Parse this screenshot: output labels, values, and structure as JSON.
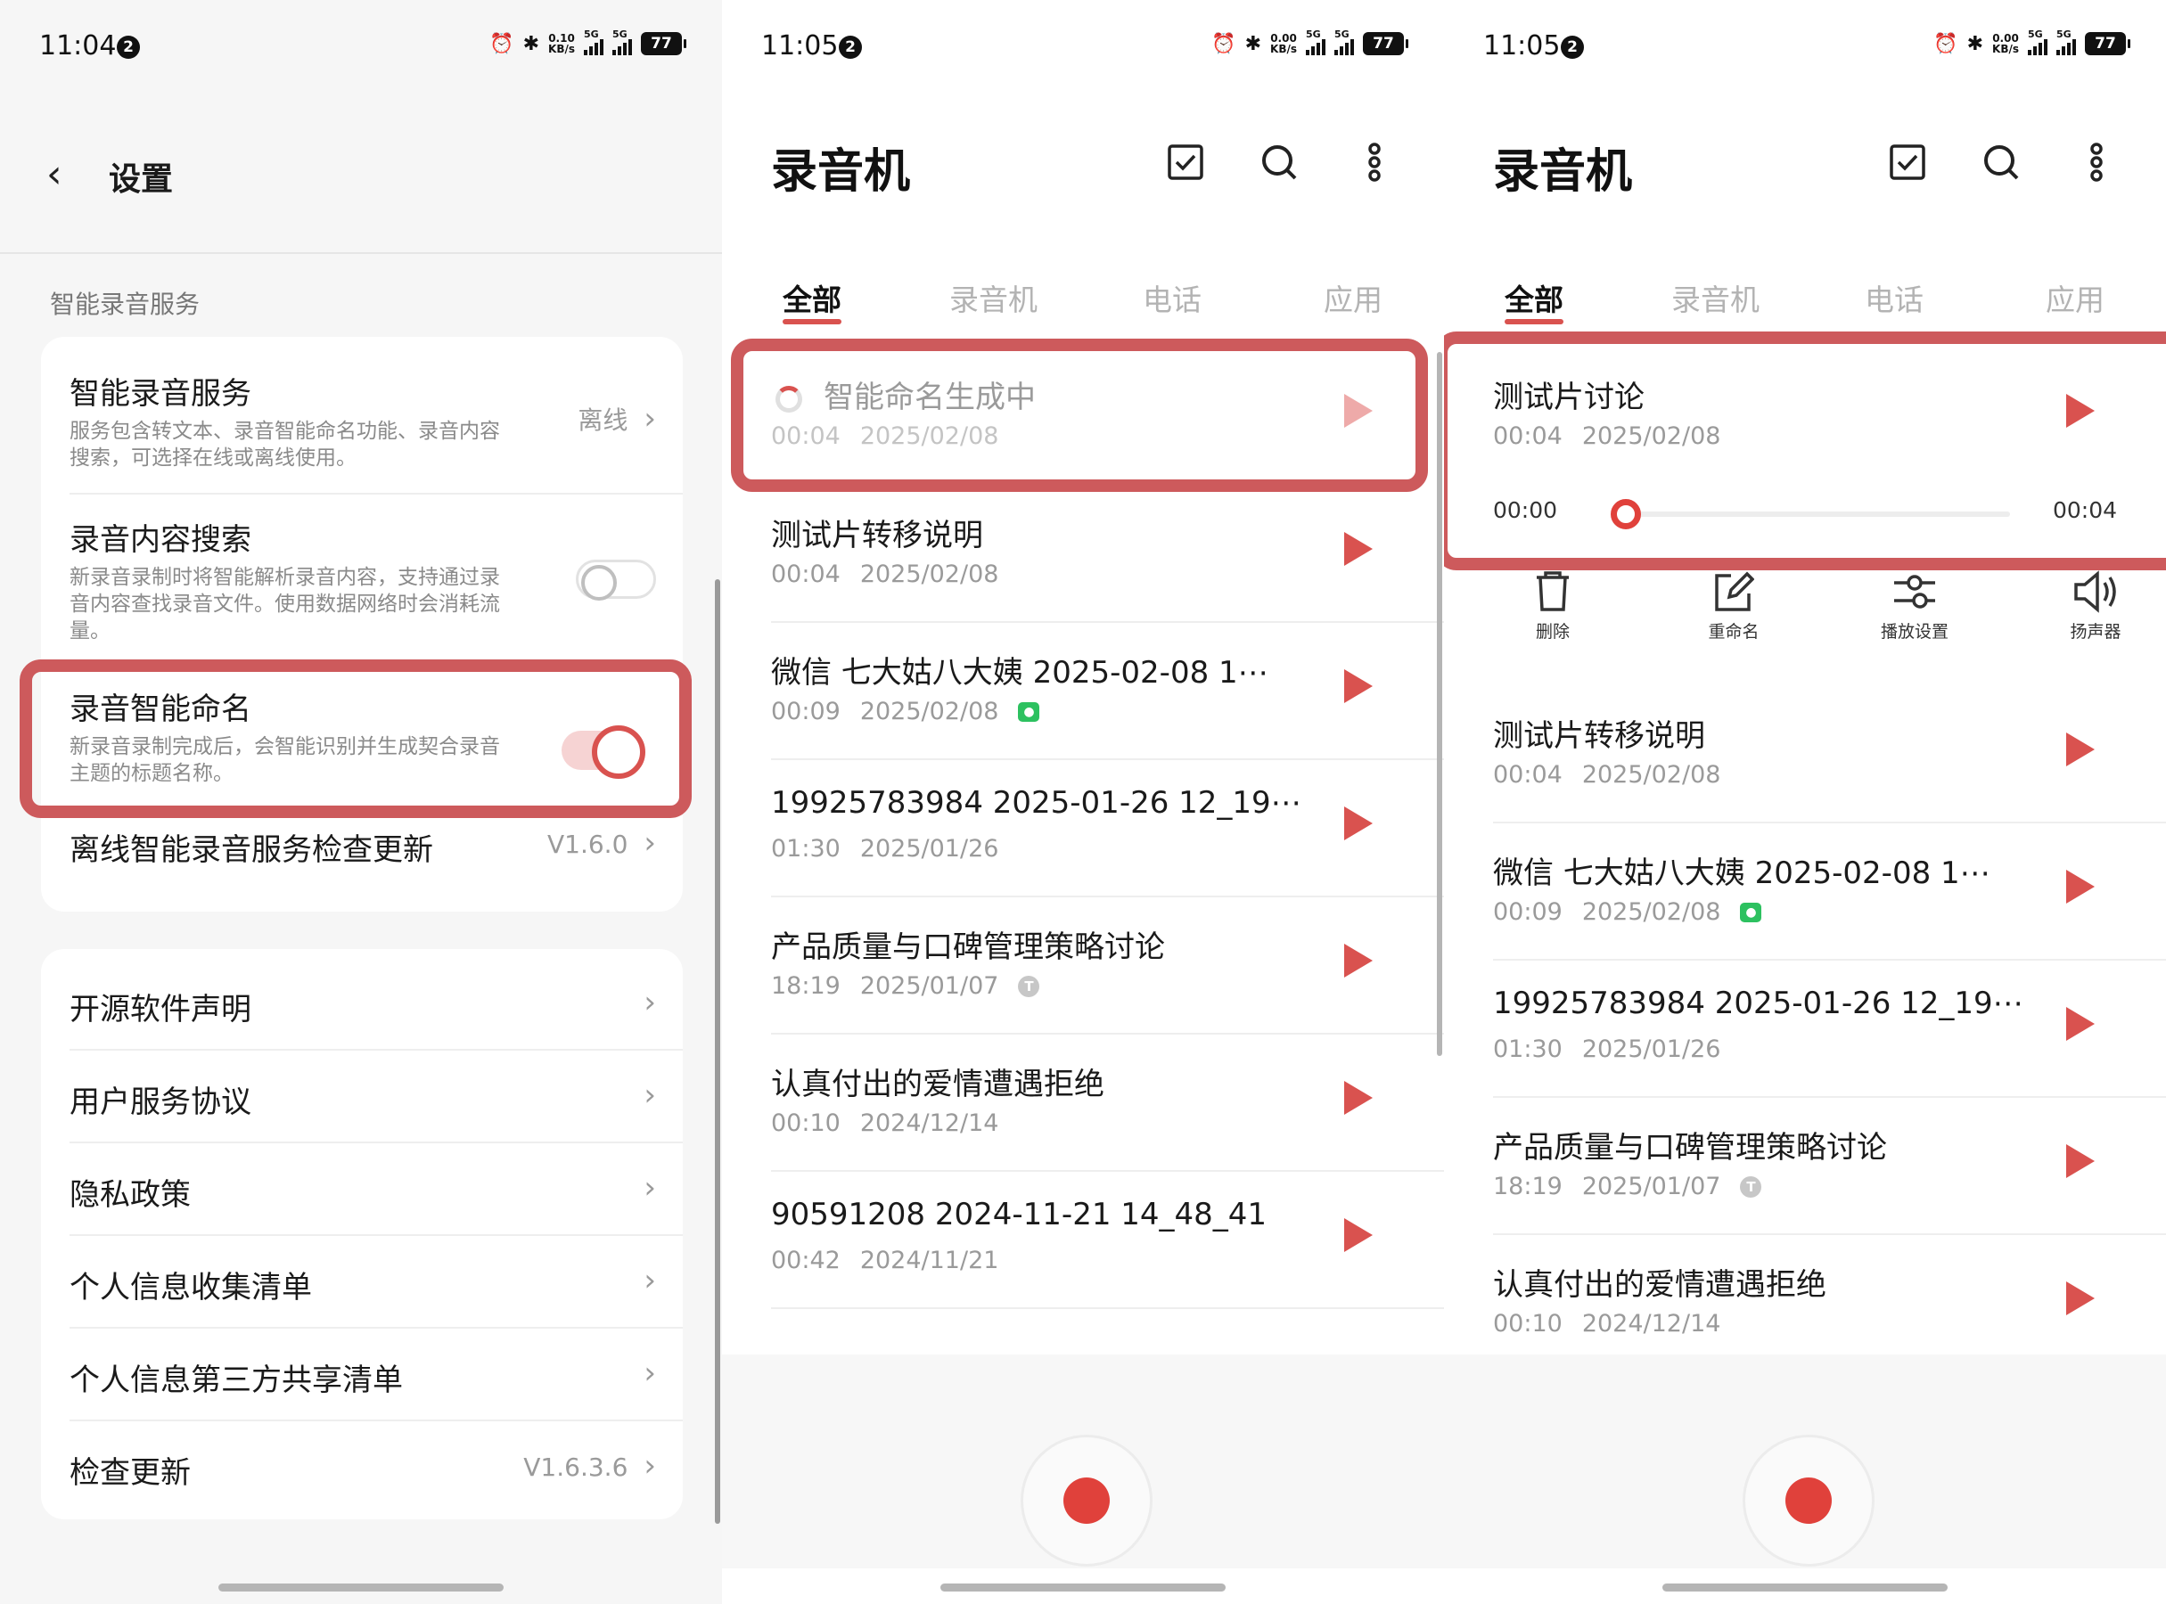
{
  "status_bars": [
    {
      "time": "11:04",
      "badge": "2",
      "speed": "0.10\nKB/s",
      "battery": "77",
      "net": "5G"
    },
    {
      "time": "11:05",
      "badge": "2",
      "speed": "0.00\nKB/s",
      "battery": "77",
      "net": "5G"
    },
    {
      "time": "11:05",
      "badge": "2",
      "speed": "0.00\nKB/s",
      "battery": "77",
      "net": "5G"
    }
  ],
  "settings": {
    "title": "设置",
    "section_label": "智能录音服务",
    "items": [
      {
        "title": "智能录音服务",
        "desc": "服务包含转文本、录音智能命名功能、录音内容搜索，可选择在线或离线使用。",
        "value": "离线"
      },
      {
        "title": "录音内容搜索",
        "desc": "新录音录制时将智能解析录音内容，支持通过录音内容查找录音文件。使用数据网络时会消耗流量。",
        "toggle": "off"
      },
      {
        "title": "录音智能命名",
        "desc": "新录音录制完成后，会智能识别并生成契合录音主题的标题名称。",
        "toggle": "on"
      },
      {
        "title": "离线智能录音服务检查更新",
        "value": "V1.6.0"
      }
    ],
    "other_items": [
      {
        "title": "开源软件声明"
      },
      {
        "title": "用户服务协议"
      },
      {
        "title": "隐私政策"
      },
      {
        "title": "个人信息收集清单"
      },
      {
        "title": "个人信息第三方共享清单"
      },
      {
        "title": "检查更新",
        "value": "V1.6.3.6"
      }
    ]
  },
  "recorder": {
    "title": "录音机",
    "tabs": [
      "全部",
      "录音机",
      "电话",
      "应用"
    ],
    "list_p2": [
      {
        "title": "智能命名生成中",
        "duration": "00:04",
        "date": "2025/02/08",
        "generating": true
      },
      {
        "title": "测试片转移说明",
        "duration": "00:04",
        "date": "2025/02/08"
      },
      {
        "title": "微信 七大姑八大姨 2025-02-08 1⋯",
        "duration": "00:09",
        "date": "2025/02/08",
        "badge": "wechat"
      },
      {
        "title": "19925783984 2025-01-26 12_19⋯",
        "duration": "01:30",
        "date": "2025/01/26"
      },
      {
        "title": "产品质量与口碑管理策略讨论",
        "duration": "18:19",
        "date": "2025/01/07",
        "badge": "T"
      },
      {
        "title": "认真付出的爱情遭遇拒绝",
        "duration": "00:10",
        "date": "2024/12/14"
      },
      {
        "title": "90591208 2024-11-21 14_48_41",
        "duration": "00:42",
        "date": "2024/11/21"
      }
    ],
    "expanded_item": {
      "title": "测试片讨论",
      "duration": "00:04",
      "date": "2025/02/08",
      "pos_start": "00:00",
      "pos_end": "00:04",
      "progress": 0
    },
    "actions": [
      "删除",
      "重命名",
      "播放设置",
      "扬声器"
    ],
    "list_p3": [
      {
        "title": "测试片转移说明",
        "duration": "00:04",
        "date": "2025/02/08"
      },
      {
        "title": "微信 七大姑八大姨 2025-02-08 1⋯",
        "duration": "00:09",
        "date": "2025/02/08",
        "badge": "wechat"
      },
      {
        "title": "19925783984 2025-01-26 12_19⋯",
        "duration": "01:30",
        "date": "2025/01/26"
      },
      {
        "title": "产品质量与口碑管理策略讨论",
        "duration": "18:19",
        "date": "2025/01/07",
        "badge": "T"
      },
      {
        "title": "认真付出的爱情遭遇拒绝",
        "duration": "00:10",
        "date": "2024/12/14"
      }
    ]
  },
  "colors": {
    "accent": "#d9524f",
    "highlight": "#cd5a5c",
    "record": "#e0413b"
  }
}
